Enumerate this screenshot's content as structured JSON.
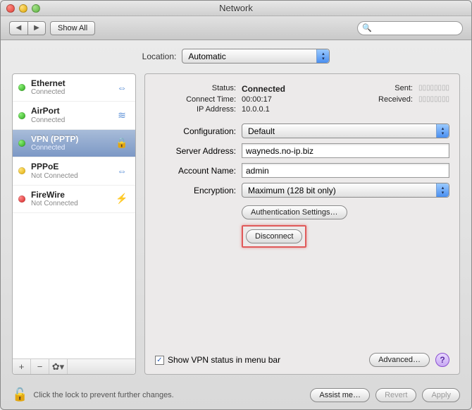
{
  "window": {
    "title": "Network"
  },
  "toolbar": {
    "show_all": "Show All",
    "search_placeholder": ""
  },
  "location": {
    "label": "Location:",
    "value": "Automatic"
  },
  "sidebar": {
    "items": [
      {
        "name": "Ethernet",
        "status": "Connected",
        "dot": "green",
        "icon": "⇔"
      },
      {
        "name": "AirPort",
        "status": "Connected",
        "dot": "green",
        "icon": "≋"
      },
      {
        "name": "VPN (PPTP)",
        "status": "Connected",
        "dot": "green",
        "icon": "🔒"
      },
      {
        "name": "PPPoE",
        "status": "Not Connected",
        "dot": "yellow",
        "icon": "⇔"
      },
      {
        "name": "FireWire",
        "status": "Not Connected",
        "dot": "red",
        "icon": "⚡"
      }
    ]
  },
  "status": {
    "label": "Status:",
    "value": "Connected",
    "connect_time_label": "Connect Time:",
    "connect_time": "00:00:17",
    "ip_label": "IP Address:",
    "ip": "10.0.0.1",
    "sent_label": "Sent:",
    "sent_bars": "▯▯▯▯▯▯▯▯",
    "recv_label": "Received:",
    "recv_bars": "▯▯▯▯▯▯▯▯"
  },
  "form": {
    "configuration_label": "Configuration:",
    "configuration": "Default",
    "server_label": "Server Address:",
    "server": "wayneds.no-ip.biz",
    "account_label": "Account Name:",
    "account": "admin",
    "encryption_label": "Encryption:",
    "encryption": "Maximum (128 bit only)",
    "auth_settings": "Authentication Settings…",
    "disconnect": "Disconnect"
  },
  "menubar": {
    "show_status": "Show VPN status in menu bar",
    "advanced": "Advanced…"
  },
  "bottom": {
    "lock_text": "Click the lock to prevent further changes.",
    "assist": "Assist me…",
    "revert": "Revert",
    "apply": "Apply"
  }
}
